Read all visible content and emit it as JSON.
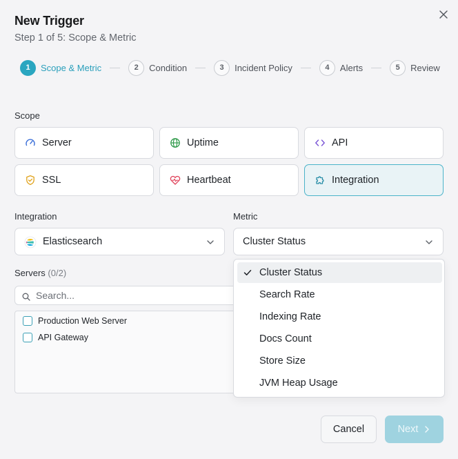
{
  "dialog": {
    "title": "New Trigger",
    "subtitle": "Step 1 of 5: Scope & Metric"
  },
  "stepper": {
    "steps": [
      {
        "num": "1",
        "label": "Scope & Metric",
        "active": true
      },
      {
        "num": "2",
        "label": "Condition"
      },
      {
        "num": "3",
        "label": "Incident Policy"
      },
      {
        "num": "4",
        "label": "Alerts"
      },
      {
        "num": "5",
        "label": "Review"
      }
    ]
  },
  "scope": {
    "label": "Scope",
    "options": [
      {
        "label": "Server",
        "icon": "gauge-icon"
      },
      {
        "label": "Uptime",
        "icon": "globe-icon"
      },
      {
        "label": "API",
        "icon": "code-icon"
      },
      {
        "label": "SSL",
        "icon": "shield-icon"
      },
      {
        "label": "Heartbeat",
        "icon": "heart-pulse-icon"
      },
      {
        "label": "Integration",
        "icon": "puzzle-icon",
        "selected": true
      }
    ]
  },
  "integration": {
    "label": "Integration",
    "value": "Elasticsearch"
  },
  "metric": {
    "label": "Metric",
    "value": "Cluster Status",
    "options": [
      "Cluster Status",
      "Search Rate",
      "Indexing Rate",
      "Docs Count",
      "Store Size",
      "JVM Heap Usage"
    ]
  },
  "servers": {
    "label": "Servers",
    "count": "(0/2)",
    "search_placeholder": "Search...",
    "items": [
      "Production Web Server",
      "API Gateway"
    ]
  },
  "actions": {
    "cancel": "Cancel",
    "next": "Next"
  },
  "colors": {
    "accent": "#2aa6c0",
    "selected_bg": "#e9f3f6",
    "next_disabled_bg": "#9fd3e0"
  }
}
